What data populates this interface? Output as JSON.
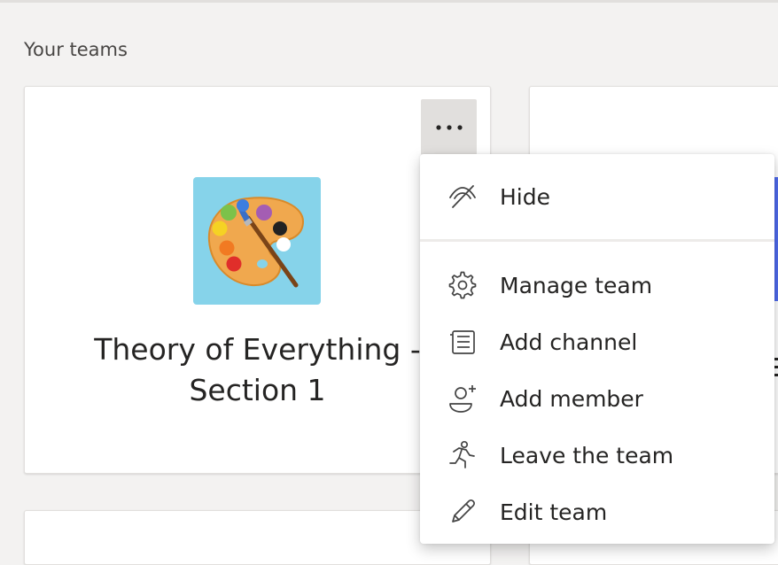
{
  "section": {
    "title": "Your teams"
  },
  "team_card": {
    "name": "Theory of Everything - Section 1"
  },
  "menu": {
    "items": [
      {
        "label": "Hide",
        "icon": "hide-eye-icon"
      },
      {
        "label": "Manage team",
        "icon": "gear-icon"
      },
      {
        "label": "Add channel",
        "icon": "channel-icon"
      },
      {
        "label": "Add member",
        "icon": "add-member-icon"
      },
      {
        "label": "Leave the team",
        "icon": "leave-icon"
      },
      {
        "label": "Edit team",
        "icon": "pencil-icon"
      }
    ]
  },
  "colors": {
    "background": "#f3f2f1",
    "card": "#ffffff",
    "accent": "#4f6bed",
    "avatar_bg": "#86d3ea",
    "text": "#252423"
  }
}
